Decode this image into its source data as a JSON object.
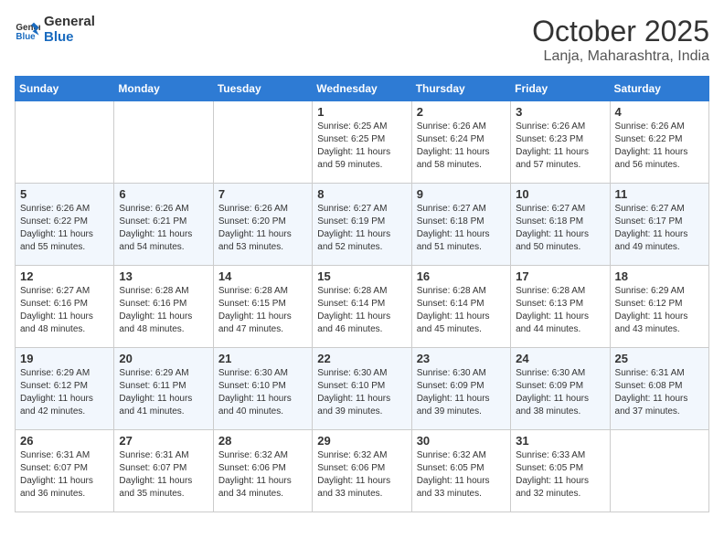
{
  "header": {
    "logo_line1": "General",
    "logo_line2": "Blue",
    "month": "October 2025",
    "location": "Lanja, Maharashtra, India"
  },
  "days_of_week": [
    "Sunday",
    "Monday",
    "Tuesday",
    "Wednesday",
    "Thursday",
    "Friday",
    "Saturday"
  ],
  "weeks": [
    [
      {
        "day": "",
        "empty": true
      },
      {
        "day": "",
        "empty": true
      },
      {
        "day": "",
        "empty": true
      },
      {
        "day": "1",
        "sunrise": "6:25 AM",
        "sunset": "6:25 PM",
        "daylight": "11 hours and 59 minutes."
      },
      {
        "day": "2",
        "sunrise": "6:26 AM",
        "sunset": "6:24 PM",
        "daylight": "11 hours and 58 minutes."
      },
      {
        "day": "3",
        "sunrise": "6:26 AM",
        "sunset": "6:23 PM",
        "daylight": "11 hours and 57 minutes."
      },
      {
        "day": "4",
        "sunrise": "6:26 AM",
        "sunset": "6:22 PM",
        "daylight": "11 hours and 56 minutes."
      }
    ],
    [
      {
        "day": "5",
        "sunrise": "6:26 AM",
        "sunset": "6:22 PM",
        "daylight": "11 hours and 55 minutes."
      },
      {
        "day": "6",
        "sunrise": "6:26 AM",
        "sunset": "6:21 PM",
        "daylight": "11 hours and 54 minutes."
      },
      {
        "day": "7",
        "sunrise": "6:26 AM",
        "sunset": "6:20 PM",
        "daylight": "11 hours and 53 minutes."
      },
      {
        "day": "8",
        "sunrise": "6:27 AM",
        "sunset": "6:19 PM",
        "daylight": "11 hours and 52 minutes."
      },
      {
        "day": "9",
        "sunrise": "6:27 AM",
        "sunset": "6:18 PM",
        "daylight": "11 hours and 51 minutes."
      },
      {
        "day": "10",
        "sunrise": "6:27 AM",
        "sunset": "6:18 PM",
        "daylight": "11 hours and 50 minutes."
      },
      {
        "day": "11",
        "sunrise": "6:27 AM",
        "sunset": "6:17 PM",
        "daylight": "11 hours and 49 minutes."
      }
    ],
    [
      {
        "day": "12",
        "sunrise": "6:27 AM",
        "sunset": "6:16 PM",
        "daylight": "11 hours and 48 minutes."
      },
      {
        "day": "13",
        "sunrise": "6:28 AM",
        "sunset": "6:16 PM",
        "daylight": "11 hours and 48 minutes."
      },
      {
        "day": "14",
        "sunrise": "6:28 AM",
        "sunset": "6:15 PM",
        "daylight": "11 hours and 47 minutes."
      },
      {
        "day": "15",
        "sunrise": "6:28 AM",
        "sunset": "6:14 PM",
        "daylight": "11 hours and 46 minutes."
      },
      {
        "day": "16",
        "sunrise": "6:28 AM",
        "sunset": "6:14 PM",
        "daylight": "11 hours and 45 minutes."
      },
      {
        "day": "17",
        "sunrise": "6:28 AM",
        "sunset": "6:13 PM",
        "daylight": "11 hours and 44 minutes."
      },
      {
        "day": "18",
        "sunrise": "6:29 AM",
        "sunset": "6:12 PM",
        "daylight": "11 hours and 43 minutes."
      }
    ],
    [
      {
        "day": "19",
        "sunrise": "6:29 AM",
        "sunset": "6:12 PM",
        "daylight": "11 hours and 42 minutes."
      },
      {
        "day": "20",
        "sunrise": "6:29 AM",
        "sunset": "6:11 PM",
        "daylight": "11 hours and 41 minutes."
      },
      {
        "day": "21",
        "sunrise": "6:30 AM",
        "sunset": "6:10 PM",
        "daylight": "11 hours and 40 minutes."
      },
      {
        "day": "22",
        "sunrise": "6:30 AM",
        "sunset": "6:10 PM",
        "daylight": "11 hours and 39 minutes."
      },
      {
        "day": "23",
        "sunrise": "6:30 AM",
        "sunset": "6:09 PM",
        "daylight": "11 hours and 39 minutes."
      },
      {
        "day": "24",
        "sunrise": "6:30 AM",
        "sunset": "6:09 PM",
        "daylight": "11 hours and 38 minutes."
      },
      {
        "day": "25",
        "sunrise": "6:31 AM",
        "sunset": "6:08 PM",
        "daylight": "11 hours and 37 minutes."
      }
    ],
    [
      {
        "day": "26",
        "sunrise": "6:31 AM",
        "sunset": "6:07 PM",
        "daylight": "11 hours and 36 minutes."
      },
      {
        "day": "27",
        "sunrise": "6:31 AM",
        "sunset": "6:07 PM",
        "daylight": "11 hours and 35 minutes."
      },
      {
        "day": "28",
        "sunrise": "6:32 AM",
        "sunset": "6:06 PM",
        "daylight": "11 hours and 34 minutes."
      },
      {
        "day": "29",
        "sunrise": "6:32 AM",
        "sunset": "6:06 PM",
        "daylight": "11 hours and 33 minutes."
      },
      {
        "day": "30",
        "sunrise": "6:32 AM",
        "sunset": "6:05 PM",
        "daylight": "11 hours and 33 minutes."
      },
      {
        "day": "31",
        "sunrise": "6:33 AM",
        "sunset": "6:05 PM",
        "daylight": "11 hours and 32 minutes."
      },
      {
        "day": "",
        "empty": true
      }
    ]
  ]
}
